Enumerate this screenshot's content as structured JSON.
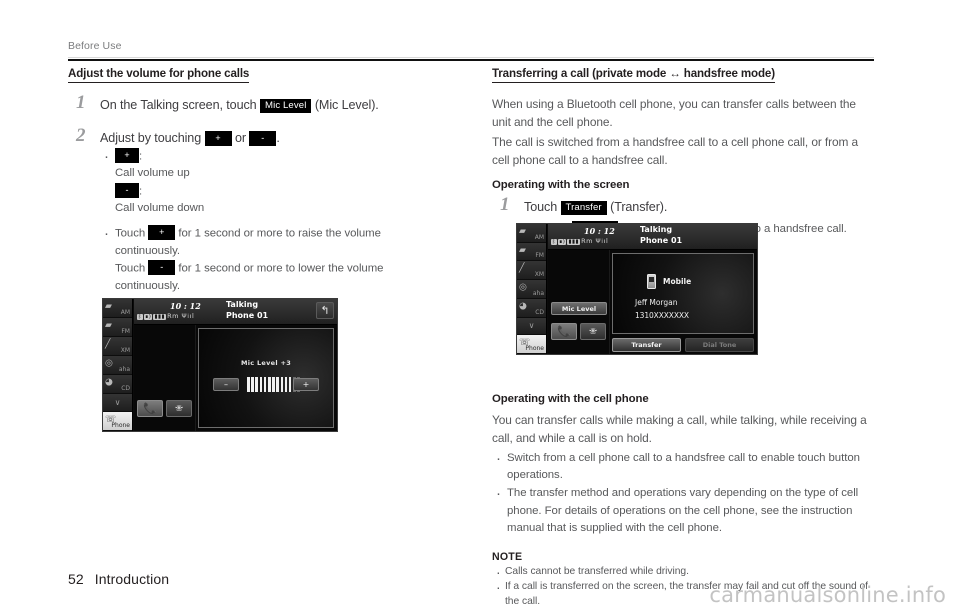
{
  "header": {
    "running_head": "Before Use"
  },
  "footer": {
    "page_number": "52",
    "section": "Introduction",
    "watermark": "carmanualsonline.info"
  },
  "left_column": {
    "section_title": "Adjust the volume for phone calls",
    "step1": {
      "number": "1",
      "text_before": "On the Talking screen, touch",
      "key": "Mic Level",
      "text_after": "(Mic Level)."
    },
    "step2": {
      "number": "2",
      "text_before": "Adjust by touching",
      "key_plus": "+",
      "text_mid": "or",
      "key_minus": "-",
      "text_after": "."
    },
    "bullets": [
      {
        "key": "+",
        "colon": ":",
        "desc": "Call volume up",
        "key2": "-",
        "colon2": ":",
        "desc2": "Call volume down"
      },
      {
        "touch1": "Touch",
        "key": "+",
        "rest1": "for 1 second or more to raise the volume",
        "cont1": "continuously.",
        "touch2": "Touch",
        "key2": "-",
        "rest2": "for 1 second or more to lower the volume",
        "cont2": "continuously."
      }
    ],
    "device": {
      "sidebar": [
        {
          "label": "AM",
          "icon": "radio-am-icon"
        },
        {
          "label": "FM",
          "icon": "radio-fm-icon"
        },
        {
          "label": "XM",
          "icon": "satellite-xm-icon"
        },
        {
          "label": "aha",
          "icon": "aha-icon"
        },
        {
          "label": "CD",
          "icon": "cd-disc-icon"
        },
        {
          "label": "∨",
          "icon": "chevron-down-icon"
        },
        {
          "label": "Phone",
          "icon": "phone-icon"
        }
      ],
      "status": {
        "clock": "10 : 12",
        "icons": "ʙ ⧺ ██ Rm ▀▄▆",
        "title": "Talking",
        "subtitle": "Phone 01",
        "back_icon": "back-arrow-icon"
      },
      "mic_level_label": "Mic Level   +3",
      "minus_label": "–",
      "plus_label": "+",
      "gauge_filled": 11,
      "gauge_dim": 2,
      "answer_icon": "answer-call-icon",
      "end_icon": "end-call-icon"
    }
  },
  "right_column": {
    "section_title": "Transferring a call (private mode ↔ handsfree mode)",
    "paragraphs": [
      "When using a Bluetooth cell phone, you can transfer calls between the unit and the cell phone.",
      "The call is switched from a handsfree call to a cell phone call, or from a cell phone call to a handsfree call."
    ],
    "sub1": "Operating with the screen",
    "step1": {
      "number": "1",
      "text_before": "Touch",
      "key": "Transfer",
      "text_after": "(Transfer)."
    },
    "step1_bullet": {
      "text_before": "Touch",
      "key": "Transfer",
      "text_after": "(Transfer) again to switch to a handsfree call."
    },
    "device": {
      "sidebar": [
        {
          "label": "AM",
          "icon": "radio-am-icon"
        },
        {
          "label": "FM",
          "icon": "radio-fm-icon"
        },
        {
          "label": "XM",
          "icon": "satellite-xm-icon"
        },
        {
          "label": "aha",
          "icon": "aha-icon"
        },
        {
          "label": "CD",
          "icon": "cd-disc-icon"
        },
        {
          "label": "∨",
          "icon": "chevron-down-icon"
        },
        {
          "label": "Phone",
          "icon": "phone-icon"
        }
      ],
      "status": {
        "clock": "10 : 12",
        "icons": "ʙ ⧺ ██ Rm ▀▄▆",
        "title": "Talking",
        "subtitle": "Phone 01"
      },
      "mic_level_button": "Mic Level",
      "mobile_label": "Mobile",
      "caller_name": "Jeff Morgan",
      "caller_number": "1310XXXXXXX",
      "transfer_button": "Transfer",
      "dial_tone_button": "Dial Tone",
      "answer_icon": "answer-call-icon",
      "end_icon": "end-call-icon"
    },
    "sub2": "Operating with the cell phone",
    "paragraph2": "You can transfer calls while making a call, while talking, while receiving a call, and while a call is on hold.",
    "bullets2": [
      "Switch from a cell phone call to a handsfree call to enable touch button operations.",
      "The transfer method and operations vary depending on the type of cell phone. For details of operations on the cell phone, see the instruction manual that is supplied with the cell phone."
    ],
    "note_title": "NOTE",
    "notes": [
      "Calls cannot be transferred while driving.",
      "If a call is transferred on the screen, the transfer may fail and cut off the sound of the call."
    ]
  }
}
